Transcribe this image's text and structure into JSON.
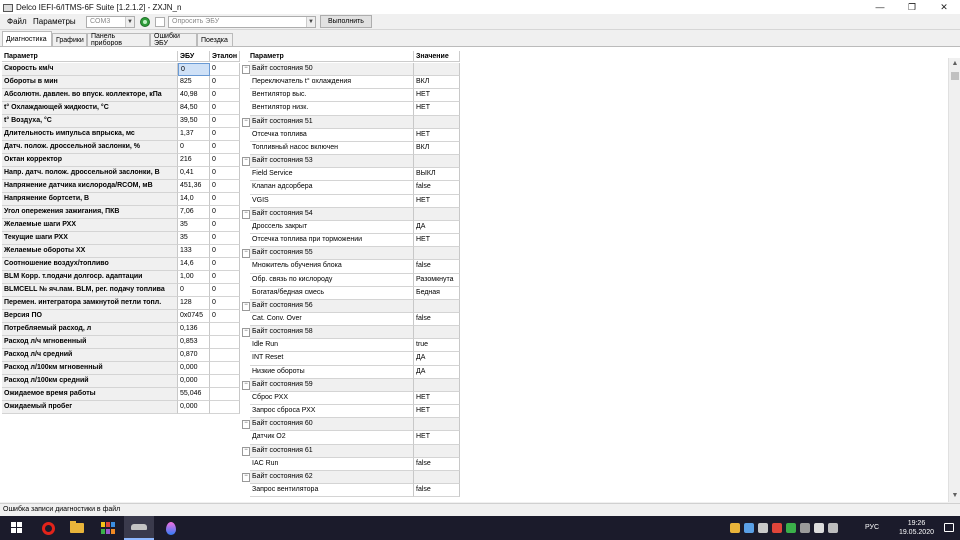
{
  "window": {
    "title": "Delco IEFI-6/ITMS-6F Suite [1.2.1.2] - ZXJN_n",
    "minimize_glyph": "—",
    "maximize_glyph": "❐",
    "close_glyph": "✕"
  },
  "menu": {
    "file": "Файл",
    "params": "Параметры",
    "port_value": "COM3",
    "poll_placeholder": "Опросить ЭБУ",
    "execute_label": "Выполнить"
  },
  "tabs": [
    "Диагностика",
    "Графики",
    "Панель приборов",
    "Ошибки ЭБУ",
    "Поездка"
  ],
  "left_table": {
    "headers": {
      "param": "Параметр",
      "ecu": "ЭБУ",
      "ref": "Эталон"
    },
    "rows": [
      {
        "param": "Скорость км/ч",
        "ecu": "0",
        "ref": "0"
      },
      {
        "param": "Обороты в мин",
        "ecu": "825",
        "ref": "0"
      },
      {
        "param": "Абсолютн. давлен. во впуск. коллекторе, кПа",
        "ecu": "40,98",
        "ref": "0"
      },
      {
        "param": "t° Охлаждающей жидкости, °C",
        "ecu": "84,50",
        "ref": "0"
      },
      {
        "param": "t° Воздуха, °C",
        "ecu": "39,50",
        "ref": "0"
      },
      {
        "param": "Длительность импульса впрыска, мс",
        "ecu": "1,37",
        "ref": "0"
      },
      {
        "param": "Датч. полож. дроссельной заслонки, %",
        "ecu": "0",
        "ref": "0"
      },
      {
        "param": "Октан корректор",
        "ecu": "216",
        "ref": "0"
      },
      {
        "param": "Напр. датч. полож. дроссельной заслонки, В",
        "ecu": "0,41",
        "ref": "0"
      },
      {
        "param": "Напряжение датчика кислорода/RCOM, мВ",
        "ecu": "451,36",
        "ref": "0"
      },
      {
        "param": "Напряжение бортсети, В",
        "ecu": "14,0",
        "ref": "0"
      },
      {
        "param": "Угол опережения зажигания, ПКВ",
        "ecu": "7,06",
        "ref": "0"
      },
      {
        "param": "Желаемые шаги РХХ",
        "ecu": "35",
        "ref": "0"
      },
      {
        "param": "Текущие шаги РХХ",
        "ecu": "35",
        "ref": "0"
      },
      {
        "param": "Желаемые обороты ХХ",
        "ecu": "133",
        "ref": "0"
      },
      {
        "param": "Соотношение воздух/топливо",
        "ecu": "14,6",
        "ref": "0"
      },
      {
        "param": "BLM Корр. т.подачи долгоср. адаптации",
        "ecu": "1,00",
        "ref": "0"
      },
      {
        "param": "BLMCELL № яч.пам. BLM, рег. подачу топлива",
        "ecu": "0",
        "ref": "0"
      },
      {
        "param": "Перемен. интегратора замкнутой петли топл.",
        "ecu": "128",
        "ref": "0"
      },
      {
        "param": "Версия ПО",
        "ecu": "0x0745",
        "ref": "0"
      },
      {
        "param": "Потребляемый расход, л",
        "ecu": "0,136",
        "ref": ""
      },
      {
        "param": "Расход л/ч мгновенный",
        "ecu": "0,853",
        "ref": ""
      },
      {
        "param": "Расход л/ч средний",
        "ecu": "0,870",
        "ref": ""
      },
      {
        "param": "Расход л/100км мгновенный",
        "ecu": "0,000",
        "ref": ""
      },
      {
        "param": "Расход л/100км средний",
        "ecu": "0,000",
        "ref": ""
      },
      {
        "param": "Ожидаемое время работы",
        "ecu": "55,046",
        "ref": ""
      },
      {
        "param": "Ожидаемый пробег",
        "ecu": "0,000",
        "ref": ""
      }
    ]
  },
  "right_table": {
    "headers": {
      "param": "Параметр",
      "value": "Значение"
    },
    "rows": [
      {
        "name": "Байт состояния 50",
        "value": "",
        "group": true
      },
      {
        "name": "Переключатель t° охлаждения",
        "value": "ВКЛ",
        "group": false
      },
      {
        "name": "Вентилятор выс.",
        "value": "НЕТ",
        "group": false
      },
      {
        "name": "Вентилятор низк.",
        "value": "НЕТ",
        "group": false
      },
      {
        "name": "Байт состояния 51",
        "value": "",
        "group": true
      },
      {
        "name": "Отсечка топлива",
        "value": "НЕТ",
        "group": false
      },
      {
        "name": "Топливный насос включен",
        "value": "ВКЛ",
        "group": false
      },
      {
        "name": "Байт состояния 53",
        "value": "",
        "group": true
      },
      {
        "name": "Field Service",
        "value": "ВЫКЛ",
        "group": false
      },
      {
        "name": "Клапан адсорбера",
        "value": "false",
        "group": false
      },
      {
        "name": "VGIS",
        "value": "НЕТ",
        "group": false
      },
      {
        "name": "Байт состояния 54",
        "value": "",
        "group": true
      },
      {
        "name": "Дроссель закрыт",
        "value": "ДА",
        "group": false
      },
      {
        "name": "Отсечка топлива при торможении",
        "value": "НЕТ",
        "group": false
      },
      {
        "name": "Байт состояния 55",
        "value": "",
        "group": true
      },
      {
        "name": "Множитель обучения блока",
        "value": "false",
        "group": false
      },
      {
        "name": "Обр. связь по кислороду",
        "value": "Разомкнута",
        "group": false
      },
      {
        "name": "Богатая/бедная смесь",
        "value": "Бедная",
        "group": false
      },
      {
        "name": "Байт состояния 56",
        "value": "",
        "group": true
      },
      {
        "name": "Cat. Conv. Over",
        "value": "false",
        "group": false
      },
      {
        "name": "Байт состояния 58",
        "value": "",
        "group": true
      },
      {
        "name": "Idle Run",
        "value": "true",
        "group": false
      },
      {
        "name": "INT Reset",
        "value": "ДА",
        "group": false
      },
      {
        "name": "Низкие обороты",
        "value": "ДА",
        "group": false
      },
      {
        "name": "Байт состояния 59",
        "value": "",
        "group": true
      },
      {
        "name": "Сброс РХХ",
        "value": "НЕТ",
        "group": false
      },
      {
        "name": "Запрос сброса РХХ",
        "value": "НЕТ",
        "group": false
      },
      {
        "name": "Байт состояния 60",
        "value": "",
        "group": true
      },
      {
        "name": "Датчик О2",
        "value": "НЕТ",
        "group": false
      },
      {
        "name": "Байт состояния 61",
        "value": "",
        "group": true
      },
      {
        "name": "IAC Run",
        "value": "false",
        "group": false
      },
      {
        "name": "Байт состояния 62",
        "value": "",
        "group": true
      },
      {
        "name": "Запрос вентилятора",
        "value": "false",
        "group": false
      }
    ]
  },
  "statusbar": {
    "message": "Ошибка записи диагностики в файл"
  },
  "taskbar": {
    "language": "РУС",
    "time": "19:26",
    "date": "19.05.2020",
    "colors": {
      "background": "#1b1b2b",
      "active_underline": "#8fb8ff"
    }
  },
  "scrollbar": {
    "up_glyph": "▲",
    "down_glyph": "▼"
  }
}
